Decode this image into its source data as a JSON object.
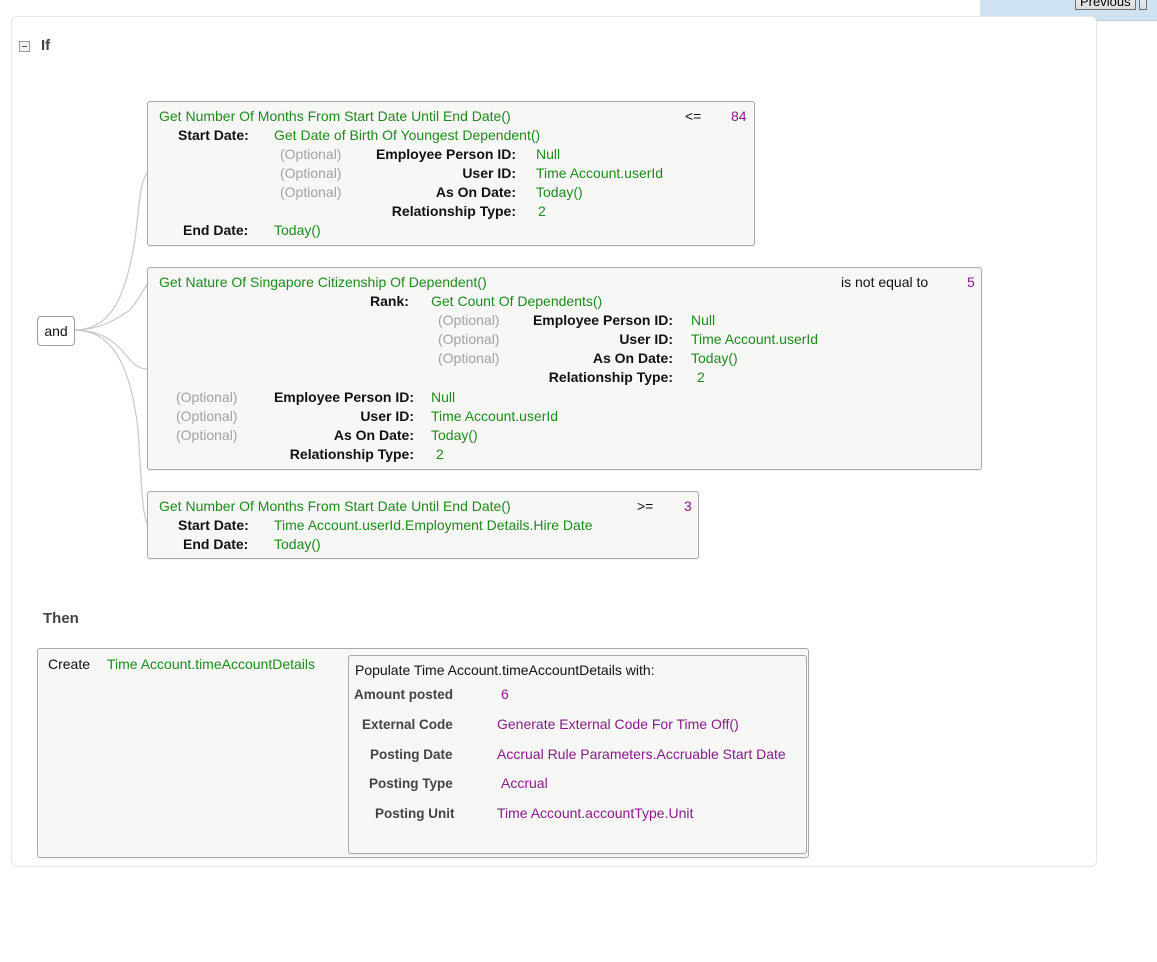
{
  "nav": {
    "previous_label": "Previous"
  },
  "if_section": {
    "label": "If",
    "operator": "and",
    "conditions": [
      {
        "function": "Get Number Of Months From Start Date Until End Date()",
        "comparator": "<=",
        "value": "84",
        "params": {
          "start_label": "Start Date:",
          "start_value": "Get Date of Birth Of Youngest Dependent()",
          "end_label": "End Date:",
          "end_value": "Today()"
        },
        "sub_params": [
          {
            "optional": "(Optional)",
            "label": "Employee Person ID:",
            "value": "Null"
          },
          {
            "optional": "(Optional)",
            "label": "User ID:",
            "value": "Time Account.userId"
          },
          {
            "optional": "(Optional)",
            "label": "As On Date:",
            "value": "Today()"
          },
          {
            "optional": "",
            "label": "Relationship Type:",
            "value": "2"
          }
        ]
      },
      {
        "function": "Get Nature Of Singapore Citizenship Of Dependent()",
        "comparator": "is not equal to",
        "value": "5",
        "rank_label": "Rank:",
        "rank_value": "Get Count Of Dependents()",
        "rank_params": [
          {
            "optional": "(Optional)",
            "label": "Employee Person ID:",
            "value": "Null"
          },
          {
            "optional": "(Optional)",
            "label": "User ID:",
            "value": "Time Account.userId"
          },
          {
            "optional": "(Optional)",
            "label": "As On Date:",
            "value": "Today()"
          },
          {
            "optional": "",
            "label": "Relationship Type:",
            "value": "2"
          }
        ],
        "params": [
          {
            "optional": "(Optional)",
            "label": "Employee Person ID:",
            "value": "Null"
          },
          {
            "optional": "(Optional)",
            "label": "User ID:",
            "value": "Time Account.userId"
          },
          {
            "optional": "(Optional)",
            "label": "As On Date:",
            "value": "Today()"
          },
          {
            "optional": "",
            "label": "Relationship Type:",
            "value": "2"
          }
        ]
      },
      {
        "function": "Get Number Of Months From Start Date Until End Date()",
        "comparator": ">=",
        "value": "3",
        "params": {
          "start_label": "Start Date:",
          "start_value": "Time Account.userId.Employment Details.Hire Date",
          "end_label": "End Date:",
          "end_value": "Today()"
        }
      }
    ]
  },
  "then_section": {
    "label": "Then",
    "action": "Create",
    "target": "Time Account.timeAccountDetails",
    "populate_title": "Populate Time Account.timeAccountDetails with:",
    "fields": [
      {
        "label": "Amount posted",
        "value": "6"
      },
      {
        "label": "External Code",
        "value": "Generate External Code For Time Off()"
      },
      {
        "label": "Posting Date",
        "value": "Accrual Rule Parameters.Accruable Start Date"
      },
      {
        "label": "Posting Type",
        "value": "Accrual"
      },
      {
        "label": "Posting Unit",
        "value": "Time Account.accountType.Unit"
      }
    ]
  }
}
